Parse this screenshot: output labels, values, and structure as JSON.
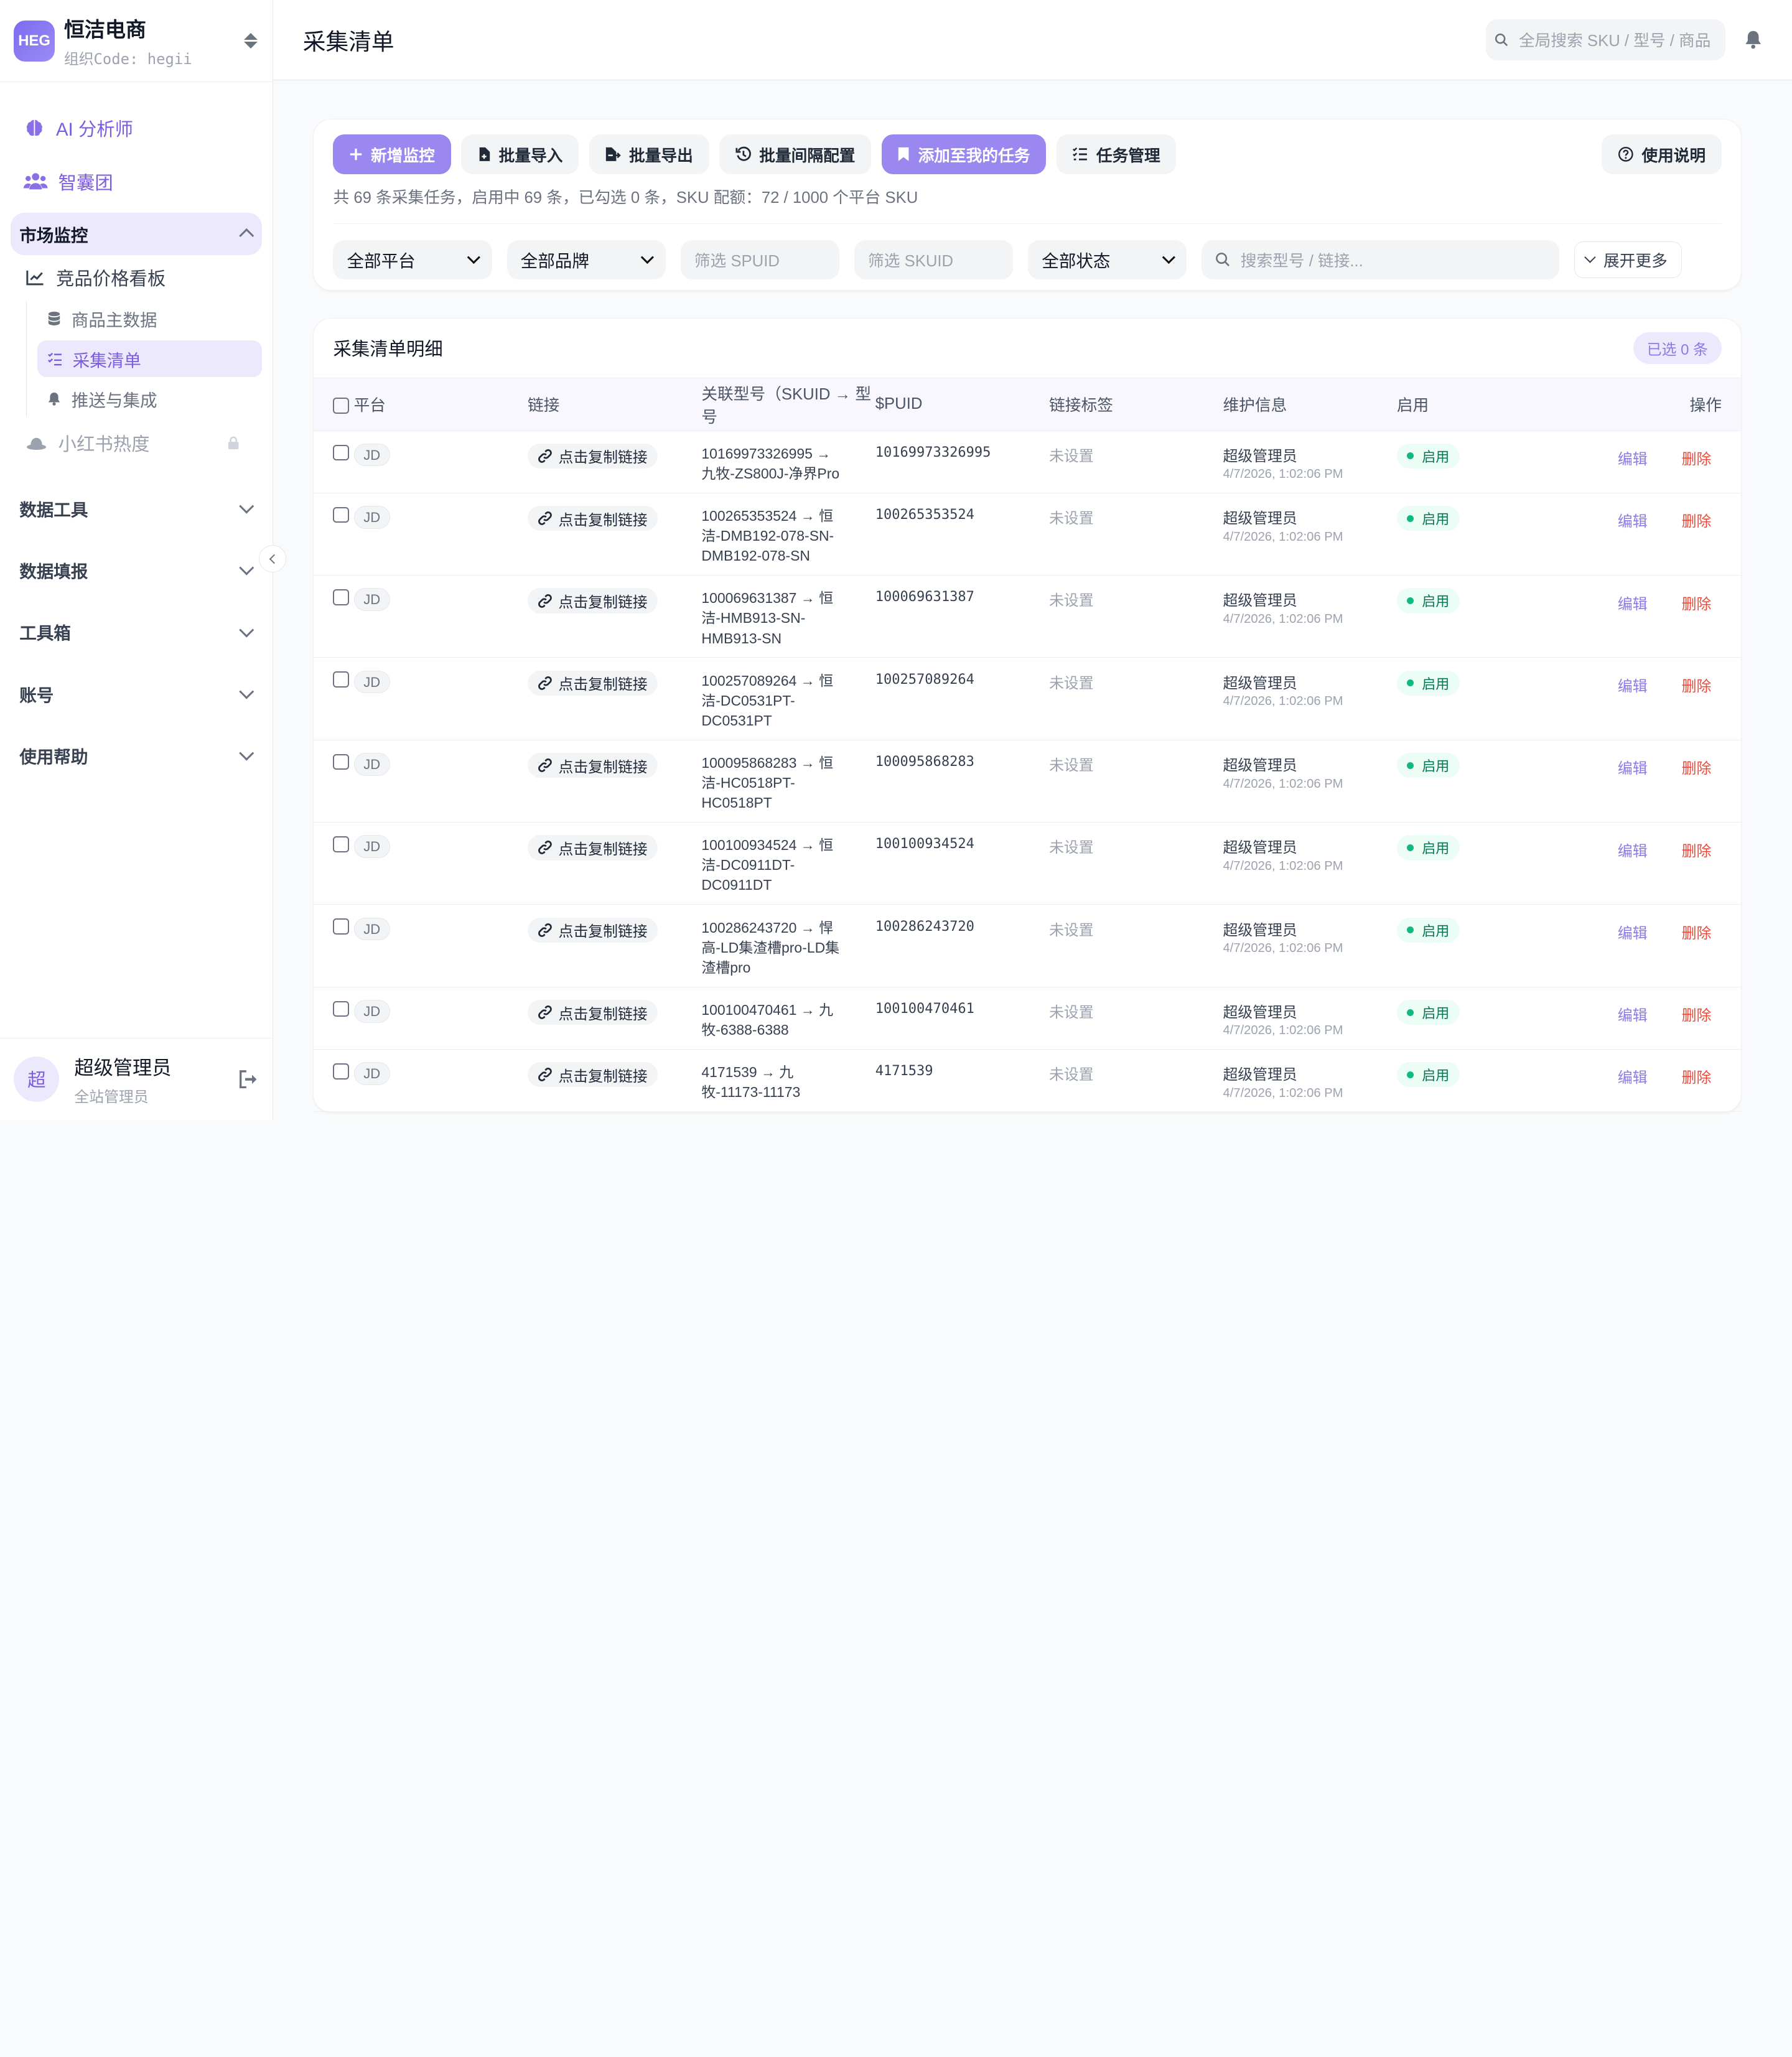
{
  "org": {
    "logo": "HEG",
    "name": "恒洁电商",
    "code": "组织Code: hegii"
  },
  "nav": {
    "ai": "AI 分析师",
    "think_tank": "智囊团",
    "market": {
      "title": "市场监控",
      "price_board": "竞品价格看板",
      "items": [
        "商品主数据",
        "采集清单",
        "推送与集成"
      ],
      "xhs": "小红书热度"
    },
    "groups": [
      "数据工具",
      "数据填报",
      "工具箱",
      "账号",
      "使用帮助"
    ]
  },
  "user": {
    "avatar": "超",
    "name": "超级管理员",
    "role": "全站管理员"
  },
  "header": {
    "title": "采集清单",
    "search_placeholder": "全局搜索 SKU / 型号 / 商品"
  },
  "toolbar": {
    "buttons": [
      "新增监控",
      "批量导入",
      "批量导出",
      "批量间隔配置",
      "添加至我的任务",
      "任务管理"
    ],
    "help": "使用说明",
    "summary": "共 69 条采集任务，启用中 69 条，已勾选 0 条，SKU 配额：72 / 1000 个平台 SKU"
  },
  "filters": {
    "platform": "全部平台",
    "brand": "全部品牌",
    "spuid_placeholder": "筛选 SPUID",
    "skuid_placeholder": "筛选 SKUID",
    "status": "全部状态",
    "search_placeholder": "搜索型号 / 链接...",
    "expand": "展开更多"
  },
  "table": {
    "title": "采集清单明细",
    "selected_badge": "已选 0 条",
    "columns": [
      "平台",
      "链接",
      "关联型号（SKUID → 型号",
      "$PUID",
      "链接标签",
      "维护信息",
      "启用",
      "操作"
    ],
    "rows": [
      {
        "platform": "JD",
        "link": "点击复制链接",
        "model": "10169973326995 → 九牧-ZS800J-净界Pro",
        "spuid": "10169973326995",
        "tag": "未设置",
        "maintainer": "超级管理员",
        "time": "4/7/2026, 1:02:06 PM",
        "status": "启用",
        "edit": "编辑",
        "delete": "删除"
      },
      {
        "platform": "JD",
        "link": "点击复制链接",
        "model": "100265353524 → 恒洁-DMB192-078-SN-DMB192-078-SN",
        "spuid": "100265353524",
        "tag": "未设置",
        "maintainer": "超级管理员",
        "time": "4/7/2026, 1:02:06 PM",
        "status": "启用",
        "edit": "编辑",
        "delete": "删除"
      },
      {
        "platform": "JD",
        "link": "点击复制链接",
        "model": "100069631387 → 恒洁-HMB913-SN-HMB913-SN",
        "spuid": "100069631387",
        "tag": "未设置",
        "maintainer": "超级管理员",
        "time": "4/7/2026, 1:02:06 PM",
        "status": "启用",
        "edit": "编辑",
        "delete": "删除"
      },
      {
        "platform": "JD",
        "link": "点击复制链接",
        "model": "100257089264 → 恒洁-DC0531PT-DC0531PT",
        "spuid": "100257089264",
        "tag": "未设置",
        "maintainer": "超级管理员",
        "time": "4/7/2026, 1:02:06 PM",
        "status": "启用",
        "edit": "编辑",
        "delete": "删除"
      },
      {
        "platform": "JD",
        "link": "点击复制链接",
        "model": "100095868283 → 恒洁-HC0518PT-HC0518PT",
        "spuid": "100095868283",
        "tag": "未设置",
        "maintainer": "超级管理员",
        "time": "4/7/2026, 1:02:06 PM",
        "status": "启用",
        "edit": "编辑",
        "delete": "删除"
      },
      {
        "platform": "JD",
        "link": "点击复制链接",
        "model": "100100934524 → 恒洁-DC0911DT-DC0911DT",
        "spuid": "100100934524",
        "tag": "未设置",
        "maintainer": "超级管理员",
        "time": "4/7/2026, 1:02:06 PM",
        "status": "启用",
        "edit": "编辑",
        "delete": "删除"
      },
      {
        "platform": "JD",
        "link": "点击复制链接",
        "model": "100286243720 → 悍高-LD集渣槽pro-LD集渣槽pro",
        "spuid": "100286243720",
        "tag": "未设置",
        "maintainer": "超级管理员",
        "time": "4/7/2026, 1:02:06 PM",
        "status": "启用",
        "edit": "编辑",
        "delete": "删除"
      },
      {
        "platform": "JD",
        "link": "点击复制链接",
        "model": "100100470461 → 九牧-6388-6388",
        "spuid": "100100470461",
        "tag": "未设置",
        "maintainer": "超级管理员",
        "time": "4/7/2026, 1:02:06 PM",
        "status": "启用",
        "edit": "编辑",
        "delete": "删除"
      },
      {
        "platform": "JD",
        "link": "点击复制链接",
        "model": "4171539 → 九牧-11173-11173",
        "spuid": "4171539",
        "tag": "未设置",
        "maintainer": "超级管理员",
        "time": "4/7/2026, 1:02:06 PM",
        "status": "启用",
        "edit": "编辑",
        "delete": "删除"
      }
    ]
  },
  "colors": {
    "accent": "#7c5ce0",
    "primary_btn": "#9a88f0",
    "danger": "#e74c3c",
    "success": "#10b981"
  },
  "icons": [
    "brain-icon",
    "users-icon",
    "chart-line-icon",
    "database-icon",
    "list-check-icon",
    "bell-icon",
    "hat-icon",
    "lock-icon",
    "plus-icon",
    "file-import-icon",
    "file-export-icon",
    "history-icon",
    "bookmark-icon",
    "tasks-icon",
    "question-icon",
    "search-icon",
    "link-icon",
    "logout-icon"
  ]
}
